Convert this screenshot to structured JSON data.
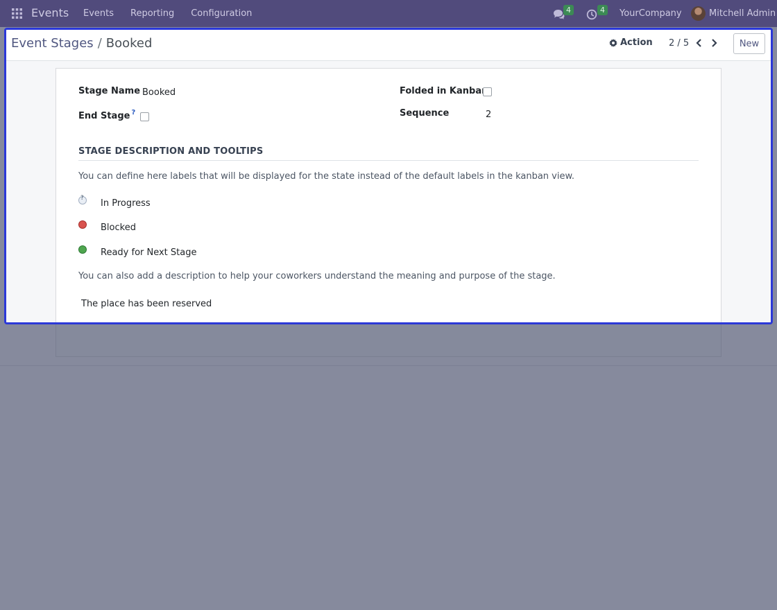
{
  "navbar": {
    "brand": "Events",
    "menu": [
      "Events",
      "Reporting",
      "Configuration"
    ],
    "messages_count": "4",
    "activities_count": "4",
    "company": "YourCompany",
    "user": "Mitchell Admin"
  },
  "control": {
    "breadcrumb_parent": "Event Stages",
    "breadcrumb_sep": "/",
    "breadcrumb_current": "Booked",
    "action_label": "Action",
    "pager": "2 / 5",
    "new_label": "New"
  },
  "form": {
    "stage_name_label": "Stage Name",
    "stage_name_value": "Booked",
    "end_stage_label": "End Stage",
    "end_stage_help": "?",
    "end_stage_checked": false,
    "folded_label": "Folded in Kanban",
    "folded_checked": false,
    "sequence_label": "Sequence",
    "sequence_value": "2",
    "section_title": "STAGE DESCRIPTION AND TOOLTIPS",
    "intro_text": "You can define here labels that will be displayed for the state instead of the default labels in the kanban view.",
    "states": [
      {
        "label": "In Progress",
        "color": "#e9eef5"
      },
      {
        "label": "Blocked",
        "color": "#d9534f"
      },
      {
        "label": "Ready for Next Stage",
        "color": "#4fa64f"
      }
    ],
    "description_hint": "You can also add a description to help your coworkers understand the meaning and purpose of the stage.",
    "description": "The place has been reserved"
  },
  "colors": {
    "navbar": "#514b7c",
    "focus_border": "#2b38d8",
    "badge": "#3c8a55",
    "overlay": "#868a9d"
  }
}
